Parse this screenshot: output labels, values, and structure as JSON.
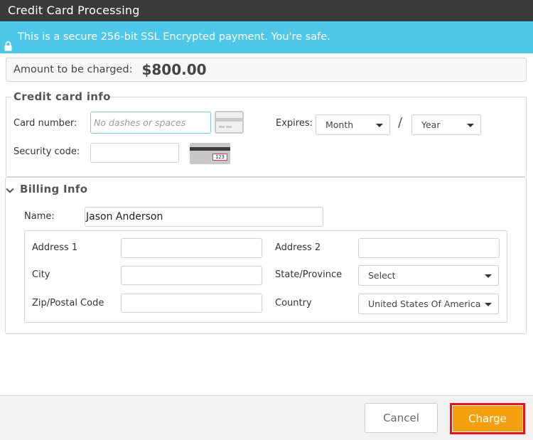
{
  "window": {
    "title": "Credit Card Processing"
  },
  "banner": {
    "text": "This is a secure 256-bit SSL Encrypted payment. You're safe.",
    "icon": "lock-icon",
    "color": "#4ec8e8"
  },
  "amount": {
    "label": "Amount to be charged:",
    "value": "$800.00"
  },
  "credit_card": {
    "section_title": "Credit card info",
    "card_number_label": "Card number:",
    "card_number_placeholder": "No dashes or spaces",
    "card_number_value": "",
    "security_code_label": "Security code:",
    "security_code_value": "",
    "cvv_icon_text": "123",
    "expires_label": "Expires:",
    "month_selected": "Month",
    "slash": "/",
    "year_selected": "Year"
  },
  "billing": {
    "section_title": "Billing Info",
    "name_label": "Name:",
    "name_value": "Jason Anderson",
    "address1_label": "Address 1",
    "address1_value": "",
    "address2_label": "Address 2",
    "address2_value": "",
    "city_label": "City",
    "city_value": "",
    "state_label": "State/Province",
    "state_selected": "Select",
    "zip_label": "Zip/Postal Code",
    "zip_value": "",
    "country_label": "Country",
    "country_selected": "United States Of America"
  },
  "footer": {
    "cancel_label": "Cancel",
    "charge_label": "Charge",
    "charge_color": "#f5a011",
    "highlight_color": "#e8121f"
  }
}
